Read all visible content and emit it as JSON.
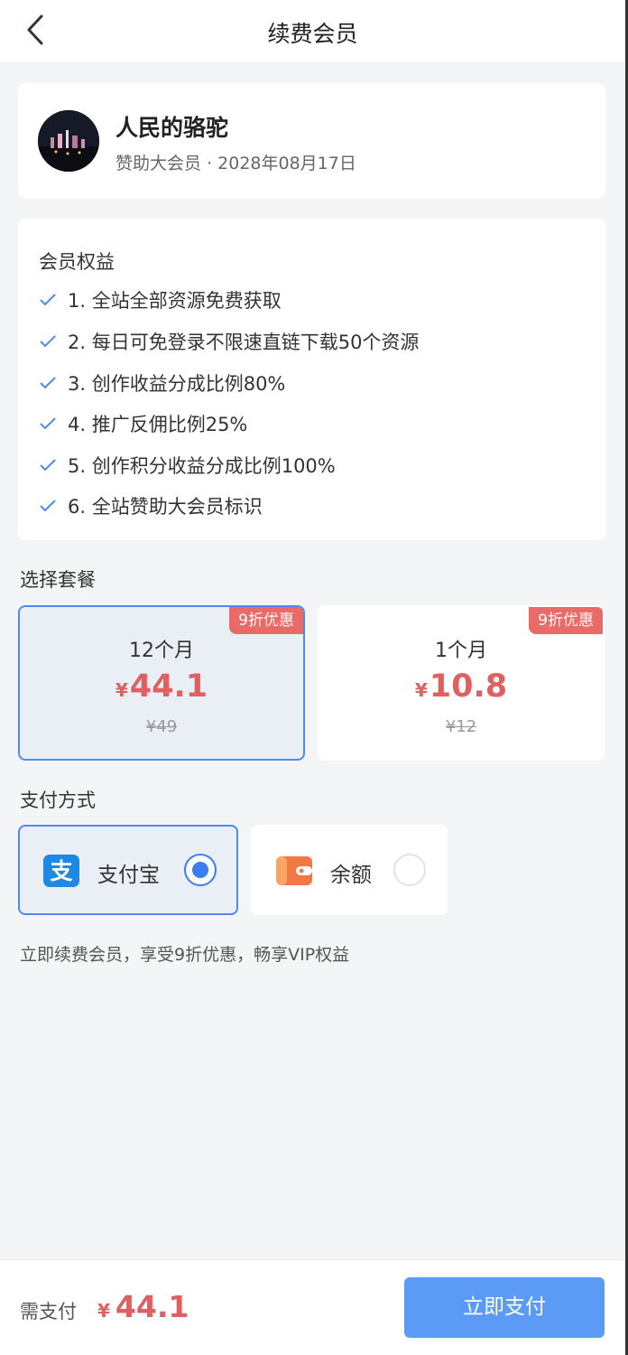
{
  "header": {
    "title": "续费会员",
    "back_icon": "chevron-left-icon"
  },
  "user": {
    "name": "人民的骆驼",
    "level": "赞助大会员",
    "separator": "·",
    "expiry": "2028年08月17日"
  },
  "benefits": {
    "title": "会员权益",
    "items": [
      "1. 全站全部资源免费获取",
      "2. 每日可免登录不限速直链下载50个资源",
      "3. 创作收益分成比例80%",
      "4. 推广反佣比例25%",
      "5. 创作积分收益分成比例100%",
      "6. 全站赞助大会员标识"
    ],
    "check_icon": "check-icon"
  },
  "plans": {
    "title": "选择套餐",
    "items": [
      {
        "badge": "9折优惠",
        "duration": "12个月",
        "currency": "¥",
        "price": "44.1",
        "original": "¥49",
        "selected": true
      },
      {
        "badge": "9折优惠",
        "duration": "1个月",
        "currency": "¥",
        "price": "10.8",
        "original": "¥12",
        "selected": false
      }
    ]
  },
  "payment": {
    "title": "支付方式",
    "methods": [
      {
        "label": "支付宝",
        "icon": "alipay-icon",
        "selected": true
      },
      {
        "label": "余额",
        "icon": "wallet-icon",
        "selected": false
      }
    ]
  },
  "promo_text": "立即续费会员，享受9折优惠，畅享VIP权益",
  "footer": {
    "need_pay_label": "需支付",
    "currency": "¥",
    "total": "44.1",
    "pay_button_label": "立即支付"
  },
  "colors": {
    "accent": "#4f8af2",
    "price": "#e05f60",
    "badge": "#ea6a68",
    "pay_button": "#5b9bf6",
    "alipay": "#1e88e5",
    "wallet": "#f07a45"
  }
}
